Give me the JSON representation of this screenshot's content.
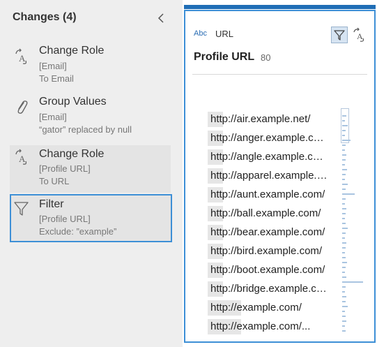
{
  "changes_panel": {
    "title": "Changes (4)",
    "items": [
      {
        "name": "Change Role",
        "details": [
          "[Email]",
          "To Email"
        ]
      },
      {
        "name": "Group Values",
        "details": [
          "[Email]",
          "“gator” replaced by null"
        ]
      },
      {
        "name": "Change Role",
        "details": [
          "[Profile URL]",
          "To URL"
        ]
      },
      {
        "name": "Filter",
        "details": [
          "[Profile URL]",
          "Exclude: ”example”"
        ]
      }
    ]
  },
  "profile_card": {
    "type_label": "Abc",
    "data_role": "URL",
    "field_title": "Profile URL",
    "distinct_count": "80",
    "values": [
      "http://air.example.net/",
      "http://anger.example.com/",
      "http://angle.example.com/",
      "http://apparel.example.com/",
      "http://aunt.example.com/",
      "http://ball.example.com/",
      "http://bear.example.com/",
      "http://bird.example.com/",
      "http://boot.example.com/",
      "http://bridge.example.com/",
      "http://example.com/",
      "http://example.com/..."
    ]
  },
  "colors": {
    "accent": "#3d8fd6",
    "top_bar": "#1f6db6",
    "panel_bg": "#eeeeee"
  }
}
